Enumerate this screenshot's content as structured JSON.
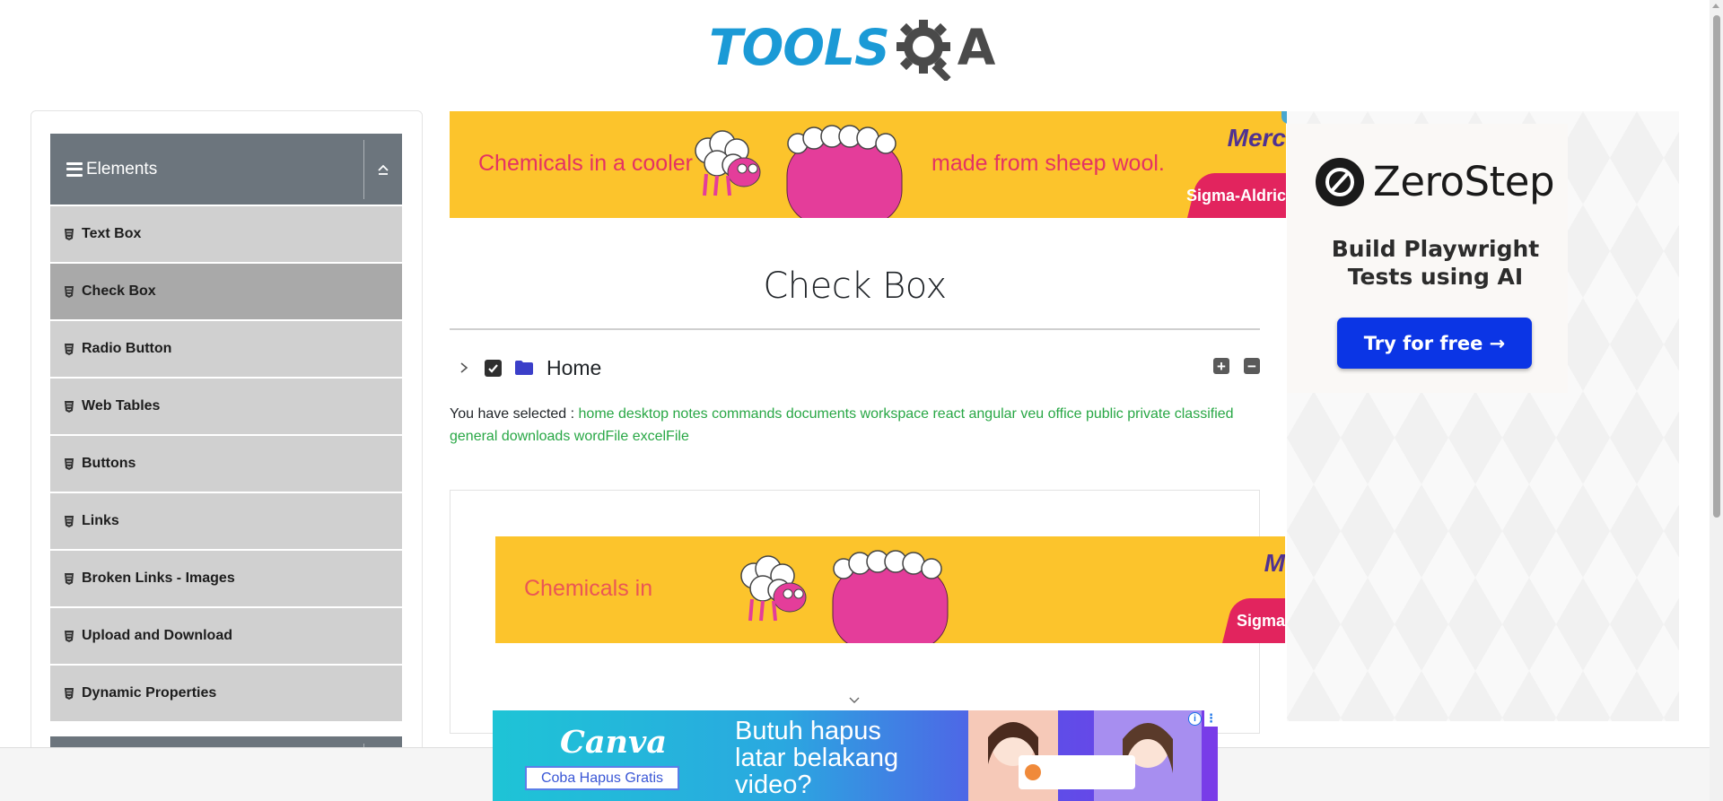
{
  "logo": {
    "text": "TOOLS",
    "accent": "A",
    "alt": "TOOLSQA"
  },
  "sidebar": {
    "group_title": "Elements",
    "items": [
      {
        "label": "Text Box",
        "active": false
      },
      {
        "label": "Check Box",
        "active": true
      },
      {
        "label": "Radio Button",
        "active": false
      },
      {
        "label": "Web Tables",
        "active": false
      },
      {
        "label": "Buttons",
        "active": false
      },
      {
        "label": "Links",
        "active": false
      },
      {
        "label": "Broken Links - Images",
        "active": false
      },
      {
        "label": "Upload and Download",
        "active": false
      },
      {
        "label": "Dynamic Properties",
        "active": false
      }
    ]
  },
  "ads": {
    "top": {
      "text_left": "Chemicals in a cooler",
      "text_right": "made from sheep wool.",
      "brand": "Merc",
      "tag": "Sigma-Aldric"
    },
    "mid": {
      "text_left": "Chemicals in",
      "brand": "M",
      "tag": "Sigma"
    },
    "right": {
      "brand": "ZeroStep",
      "tagline_1": "Build Playwright",
      "tagline_2": "Tests using AI",
      "cta": "Try for free →"
    },
    "bottom": {
      "brand": "Canva",
      "cta": "Coba Hapus Gratis",
      "headline_1": "Butuh hapus",
      "headline_2": "latar belakang",
      "headline_3": "video?"
    }
  },
  "main": {
    "title": "Check Box",
    "tree": {
      "root_label": "Home",
      "expand_all": "+",
      "collapse_all": "−"
    },
    "result": {
      "prefix": "You have selected :",
      "selected": [
        "home",
        "desktop",
        "notes",
        "commands",
        "documents",
        "workspace",
        "react",
        "angular",
        "veu",
        "office",
        "public",
        "private",
        "classified",
        "general",
        "downloads",
        "wordFile",
        "excelFile"
      ]
    }
  },
  "colors": {
    "sidebar_header": "#6c757d",
    "menu_item": "#d0d0d0",
    "menu_item_active": "#a9a9a9",
    "selected_text": "#28a745",
    "ad_yellow": "#fcc42c",
    "ad_pink": "#e43263",
    "zerostep_button": "#0b35e5"
  }
}
